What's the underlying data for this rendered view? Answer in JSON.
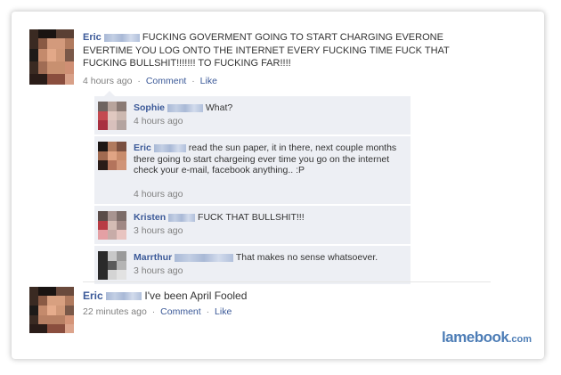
{
  "post1": {
    "author_first": "Eric",
    "text": "FUCKING GOVERMENT GOING TO START CHARGING EVERONE EVERTIME YOU LOG ONTO THE INTERNET EVERY FUCKING TIME FUCK THAT FUCKING BULLSHIT!!!!!!! TO FUCKING FAR!!!!",
    "time": "4 hours ago",
    "comment_label": "Comment",
    "like_label": "Like",
    "separator": "·"
  },
  "comments": [
    {
      "author_first": "Sophie",
      "text": "What?",
      "time": "4 hours ago"
    },
    {
      "author_first": "Eric",
      "text": "read the sun paper, it in there, next couple months there going to start chargeing ever time you go on the internet check your e-mail, facebook anything.. :P",
      "time": "4 hours ago"
    },
    {
      "author_first": "Kristen",
      "text": "FUCK THAT BULLSHIT!!!",
      "time": "3 hours ago"
    },
    {
      "author_first": "Marrthur",
      "text": "That makes no sense whatsoever.",
      "time": "3 hours ago"
    }
  ],
  "post2": {
    "author_first": "Eric",
    "text": "I've been April Fooled",
    "time": "22 minutes ago",
    "comment_label": "Comment",
    "like_label": "Like",
    "separator": "·"
  },
  "watermark": {
    "main": "lamebook",
    "suffix": ".com"
  },
  "colors": {
    "link": "#3b5998",
    "comment_bg": "#edeff4",
    "watermark": "#4d7db6",
    "meta": "#808080"
  },
  "icons": {
    "avatars": "pixelated-profile-photo"
  }
}
